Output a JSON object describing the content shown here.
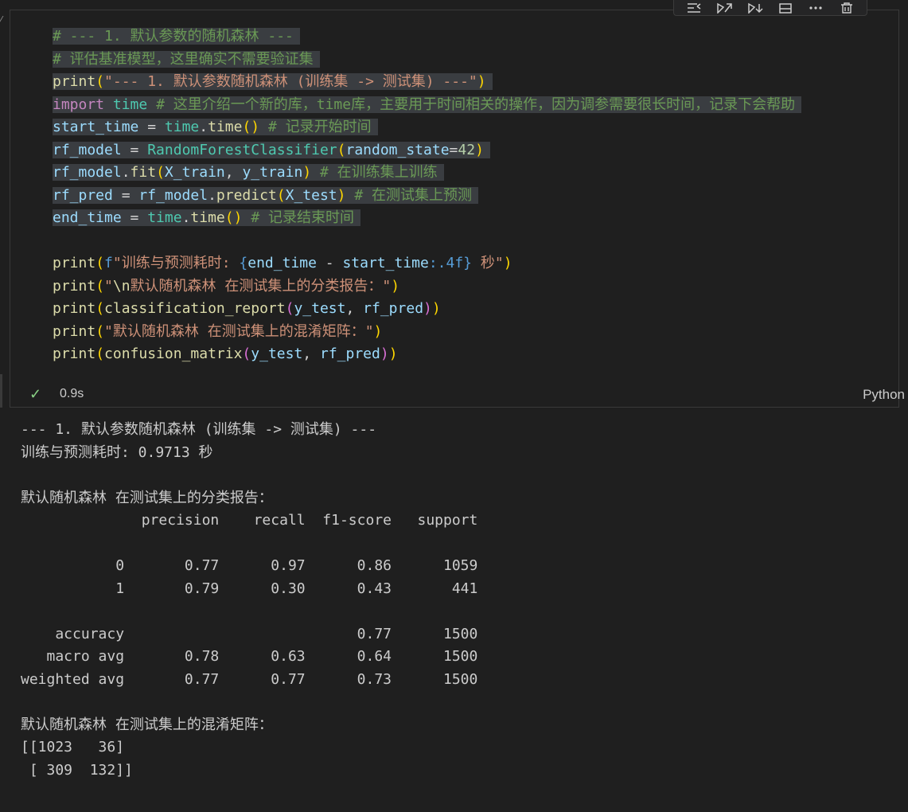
{
  "toolbar": {
    "buttons": [
      {
        "name": "execute-above-cells-icon"
      },
      {
        "name": "execute-cell-and-below-icon"
      },
      {
        "name": "split-cell-icon"
      },
      {
        "name": "collapse-cell-icon"
      },
      {
        "name": "more-actions-icon"
      },
      {
        "name": "delete-cell-icon"
      }
    ]
  },
  "cell": {
    "code_lines": [
      [
        {
          "c": "cm",
          "t": "# --- 1. 默认参数的随机森林 ---"
        }
      ],
      [
        {
          "c": "cm",
          "t": "# 评估基准模型，这里确实不需要验证集"
        }
      ],
      [
        {
          "c": "fn",
          "t": "print"
        },
        {
          "c": "b1",
          "t": "("
        },
        {
          "c": "st",
          "t": "\"--- 1. 默认参数随机森林 (训练集 -> 测试集) ---\""
        },
        {
          "c": "b1",
          "t": ")"
        }
      ],
      [
        {
          "c": "kw2",
          "t": "import"
        },
        {
          "c": "op",
          "t": " "
        },
        {
          "c": "cl",
          "t": "time"
        },
        {
          "c": "op",
          "t": " "
        },
        {
          "c": "cm",
          "t": "# 这里介绍一个新的库，time库，主要用于时间相关的操作，因为调参需要很长时间，记录下会帮助"
        }
      ],
      [
        {
          "c": "va",
          "t": "start_time"
        },
        {
          "c": "op",
          "t": " = "
        },
        {
          "c": "cl",
          "t": "time"
        },
        {
          "c": "op",
          "t": "."
        },
        {
          "c": "fn",
          "t": "time"
        },
        {
          "c": "b1",
          "t": "()"
        },
        {
          "c": "op",
          "t": " "
        },
        {
          "c": "cm",
          "t": "# 记录开始时间"
        }
      ],
      [
        {
          "c": "va",
          "t": "rf_model"
        },
        {
          "c": "op",
          "t": " = "
        },
        {
          "c": "cl",
          "t": "RandomForestClassifier"
        },
        {
          "c": "b1",
          "t": "("
        },
        {
          "c": "va",
          "t": "random_state"
        },
        {
          "c": "op",
          "t": "="
        },
        {
          "c": "nu",
          "t": "42"
        },
        {
          "c": "b1",
          "t": ")"
        }
      ],
      [
        {
          "c": "va",
          "t": "rf_model"
        },
        {
          "c": "op",
          "t": "."
        },
        {
          "c": "fn",
          "t": "fit"
        },
        {
          "c": "b1",
          "t": "("
        },
        {
          "c": "va",
          "t": "X_train"
        },
        {
          "c": "op",
          "t": ", "
        },
        {
          "c": "va",
          "t": "y_train"
        },
        {
          "c": "b1",
          "t": ")"
        },
        {
          "c": "op",
          "t": " "
        },
        {
          "c": "cm",
          "t": "# 在训练集上训练"
        }
      ],
      [
        {
          "c": "va",
          "t": "rf_pred"
        },
        {
          "c": "op",
          "t": " = "
        },
        {
          "c": "va",
          "t": "rf_model"
        },
        {
          "c": "op",
          "t": "."
        },
        {
          "c": "fn",
          "t": "predict"
        },
        {
          "c": "b1",
          "t": "("
        },
        {
          "c": "va",
          "t": "X_test"
        },
        {
          "c": "b1",
          "t": ")"
        },
        {
          "c": "op",
          "t": " "
        },
        {
          "c": "cm",
          "t": "# 在测试集上预测"
        }
      ],
      [
        {
          "c": "va",
          "t": "end_time"
        },
        {
          "c": "op",
          "t": " = "
        },
        {
          "c": "cl",
          "t": "time"
        },
        {
          "c": "op",
          "t": "."
        },
        {
          "c": "fn",
          "t": "time"
        },
        {
          "c": "b1",
          "t": "()"
        },
        {
          "c": "op",
          "t": " "
        },
        {
          "c": "cm",
          "t": "# 记录结束时间"
        }
      ],
      [],
      [
        {
          "c": "fn",
          "t": "print"
        },
        {
          "c": "b1",
          "t": "("
        },
        {
          "c": "kw",
          "t": "f"
        },
        {
          "c": "st",
          "t": "\"训练与预测耗时: "
        },
        {
          "c": "kw",
          "t": "{"
        },
        {
          "c": "va",
          "t": "end_time"
        },
        {
          "c": "op",
          "t": " - "
        },
        {
          "c": "va",
          "t": "start_time"
        },
        {
          "c": "kw",
          "t": ":.4f}"
        },
        {
          "c": "st",
          "t": " 秒\""
        },
        {
          "c": "b1",
          "t": ")"
        }
      ],
      [
        {
          "c": "fn",
          "t": "print"
        },
        {
          "c": "b1",
          "t": "("
        },
        {
          "c": "st",
          "t": "\""
        },
        {
          "c": "fn",
          "t": "\\n"
        },
        {
          "c": "st",
          "t": "默认随机森林 在测试集上的分类报告：\""
        },
        {
          "c": "b1",
          "t": ")"
        }
      ],
      [
        {
          "c": "fn",
          "t": "print"
        },
        {
          "c": "b1",
          "t": "("
        },
        {
          "c": "fn",
          "t": "classification_report"
        },
        {
          "c": "b2",
          "t": "("
        },
        {
          "c": "va",
          "t": "y_test"
        },
        {
          "c": "op",
          "t": ", "
        },
        {
          "c": "va",
          "t": "rf_pred"
        },
        {
          "c": "b2",
          "t": ")"
        },
        {
          "c": "b1",
          "t": ")"
        }
      ],
      [
        {
          "c": "fn",
          "t": "print"
        },
        {
          "c": "b1",
          "t": "("
        },
        {
          "c": "st",
          "t": "\"默认随机森林 在测试集上的混淆矩阵：\""
        },
        {
          "c": "b1",
          "t": ")"
        }
      ],
      [
        {
          "c": "fn",
          "t": "print"
        },
        {
          "c": "b1",
          "t": "("
        },
        {
          "c": "fn",
          "t": "confusion_matrix"
        },
        {
          "c": "b2",
          "t": "("
        },
        {
          "c": "va",
          "t": "y_test"
        },
        {
          "c": "op",
          "t": ", "
        },
        {
          "c": "va",
          "t": "rf_pred"
        },
        {
          "c": "b2",
          "t": ")"
        },
        {
          "c": "b1",
          "t": ")"
        }
      ]
    ],
    "selected_line_count": 9,
    "status": {
      "check": "✓",
      "exec_time": "0.9s",
      "language": "Python"
    }
  },
  "output": {
    "lines": [
      "--- 1. 默认参数随机森林 (训练集 -> 测试集) ---",
      "训练与预测耗时: 0.9713 秒",
      "",
      "默认随机森林 在测试集上的分类报告：",
      "              precision    recall  f1-score   support",
      "",
      "           0       0.77      0.97      0.86      1059",
      "           1       0.79      0.30      0.43       441",
      "",
      "    accuracy                           0.77      1500",
      "   macro avg       0.78      0.63      0.64      1500",
      "weighted avg       0.77      0.77      0.73      1500",
      "",
      "默认随机森林 在测试集上的混淆矩阵：",
      "[[1023   36]",
      " [ 309  132]]"
    ]
  }
}
